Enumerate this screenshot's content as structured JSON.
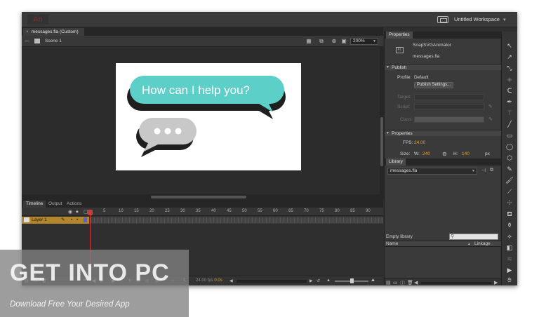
{
  "app": {
    "logo": "An"
  },
  "workspace": {
    "label": "Untitled Workspace"
  },
  "document": {
    "tab_label": "messages.fla (Custom)"
  },
  "edit_bar": {
    "scene_label": "Scene 1",
    "zoom_value": "200%"
  },
  "stage": {
    "bubble_text": "How can I help you?",
    "bubble_color": "#5ccfc9",
    "typing_bubble_color": "#c8c8c8"
  },
  "timeline": {
    "tabs": [
      "Timeline",
      "Output",
      "Actions"
    ],
    "frame_numbers": [
      "5",
      "10",
      "15",
      "20",
      "25",
      "30",
      "35",
      "40",
      "45",
      "50",
      "55",
      "60",
      "65",
      "70",
      "75",
      "80",
      "85",
      "90"
    ],
    "layer_name": "Layer 1",
    "frame_value": "1",
    "fps_label": "24.00 fps",
    "time_value": "0.0s"
  },
  "properties": {
    "tab_label": "Properties",
    "publisher": "SnapSVGAnimator",
    "file_name": "messages.fla",
    "publish_section": "Publish",
    "profile_label": "Profile:",
    "profile_value": "Default",
    "publish_settings_button": "Publish Settings...",
    "target_label": "Target:",
    "script_label": "Script:",
    "class_label": "Class:",
    "props_section": "Properties",
    "fps_label": "FPS:",
    "fps_value": "24.00",
    "size_label": "Size:",
    "width_label": "W:",
    "width_value": "240",
    "height_label": "H:",
    "height_value": "140",
    "unit": "px"
  },
  "library": {
    "tab_label": "Library",
    "file_select": "messages.fla",
    "empty_label": "Empty library",
    "col_name": "Name",
    "col_linkage": "Linkage"
  },
  "watermark": {
    "title": "GET INTO PC",
    "subtitle": "Download Free Your Desired App"
  }
}
